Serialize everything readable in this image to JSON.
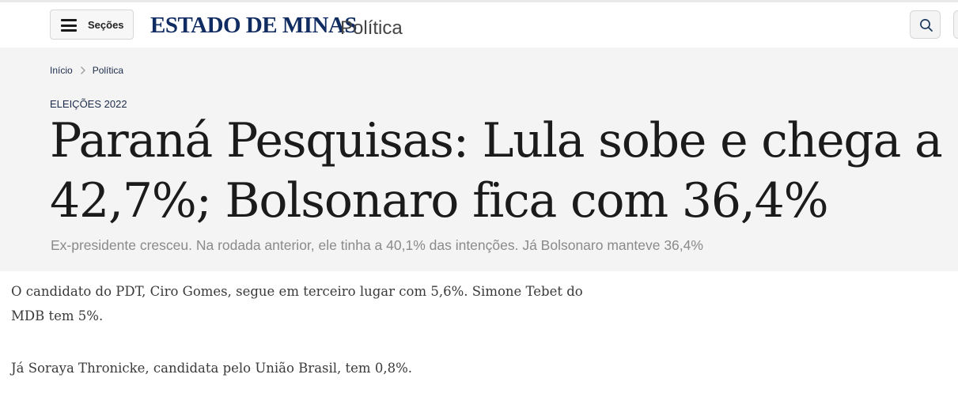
{
  "header": {
    "menu_button_label": "Seções",
    "logo_text": "ESTADO DE MINAS",
    "section_name": "Política"
  },
  "breadcrumb": {
    "items": [
      {
        "label": "Início"
      },
      {
        "label": "Política"
      }
    ]
  },
  "article": {
    "kicker": "ELEIÇÕES 2022",
    "headline_line1": "Paraná Pesquisas: Lula sobe e chega a",
    "headline_line2": "42,7%; Bolsonaro fica com 36,4%",
    "subtitle": "Ex-presidente cresceu. Na rodada anterior, ele tinha a 40,1% das intenções. Já Bolsonaro manteve 36,4%",
    "paragraphs": [
      {
        "line1": "O candidato do PDT, Ciro Gomes, segue em terceiro lugar com 5,6%. Simone Tebet do",
        "line2": "MDB tem 5%."
      },
      {
        "line1": "Já Soraya Thronicke, candidata pelo União Brasil, tem 0,8%."
      }
    ]
  },
  "colors": {
    "logo": "#102c61",
    "hero_background": "#f4f4f4",
    "link_navy": "#1c2b4a"
  },
  "icons": [
    "hamburger-icon",
    "search-icon",
    "chevron-right-icon"
  ]
}
